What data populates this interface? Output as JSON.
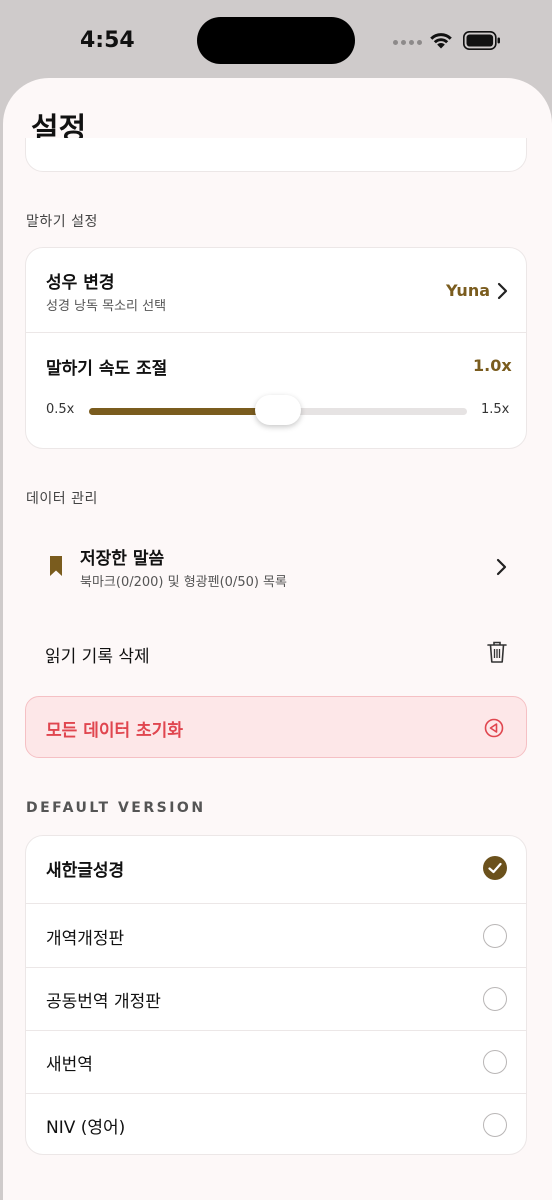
{
  "status_bar": {
    "time": "4:54"
  },
  "header": {
    "title": "설정"
  },
  "speech_section": {
    "label": "말하기 설정",
    "voice": {
      "title": "성우 변경",
      "subtitle": "성경 낭독 목소리 선택",
      "value": "Yuna"
    },
    "speed": {
      "title": "말하기 속도 조절",
      "value_label": "1.0x",
      "min_label": "0.5x",
      "max_label": "1.5x",
      "value": 1.0,
      "min": 0.5,
      "max": 1.5
    }
  },
  "data_section": {
    "label": "데이터 관리",
    "saved_words": {
      "title": "저장한 말씀",
      "subtitle": "북마크(0/200) 및 형광펜(0/50) 목록"
    },
    "delete_history": {
      "title": "읽기 기록 삭제"
    },
    "reset_all": {
      "title": "모든 데이터 초기화"
    }
  },
  "version_section": {
    "label": "DEFAULT VERSION",
    "items": [
      {
        "label": "새한글성경",
        "selected": true
      },
      {
        "label": "개역개정판",
        "selected": false
      },
      {
        "label": "공동번역 개정판",
        "selected": false
      },
      {
        "label": "새번역",
        "selected": false
      },
      {
        "label": "NIV (영어)",
        "selected": false
      }
    ]
  },
  "colors": {
    "accent": "#7a5c1e",
    "danger": "#e0464f",
    "danger_bg": "#fde7e8",
    "sheet_bg": "#fdf8f8"
  },
  "icons": [
    "wifi-icon",
    "battery-icon",
    "chevron-right-icon",
    "bookmark-icon",
    "trash-icon",
    "reset-icon",
    "checkmark-icon"
  ]
}
